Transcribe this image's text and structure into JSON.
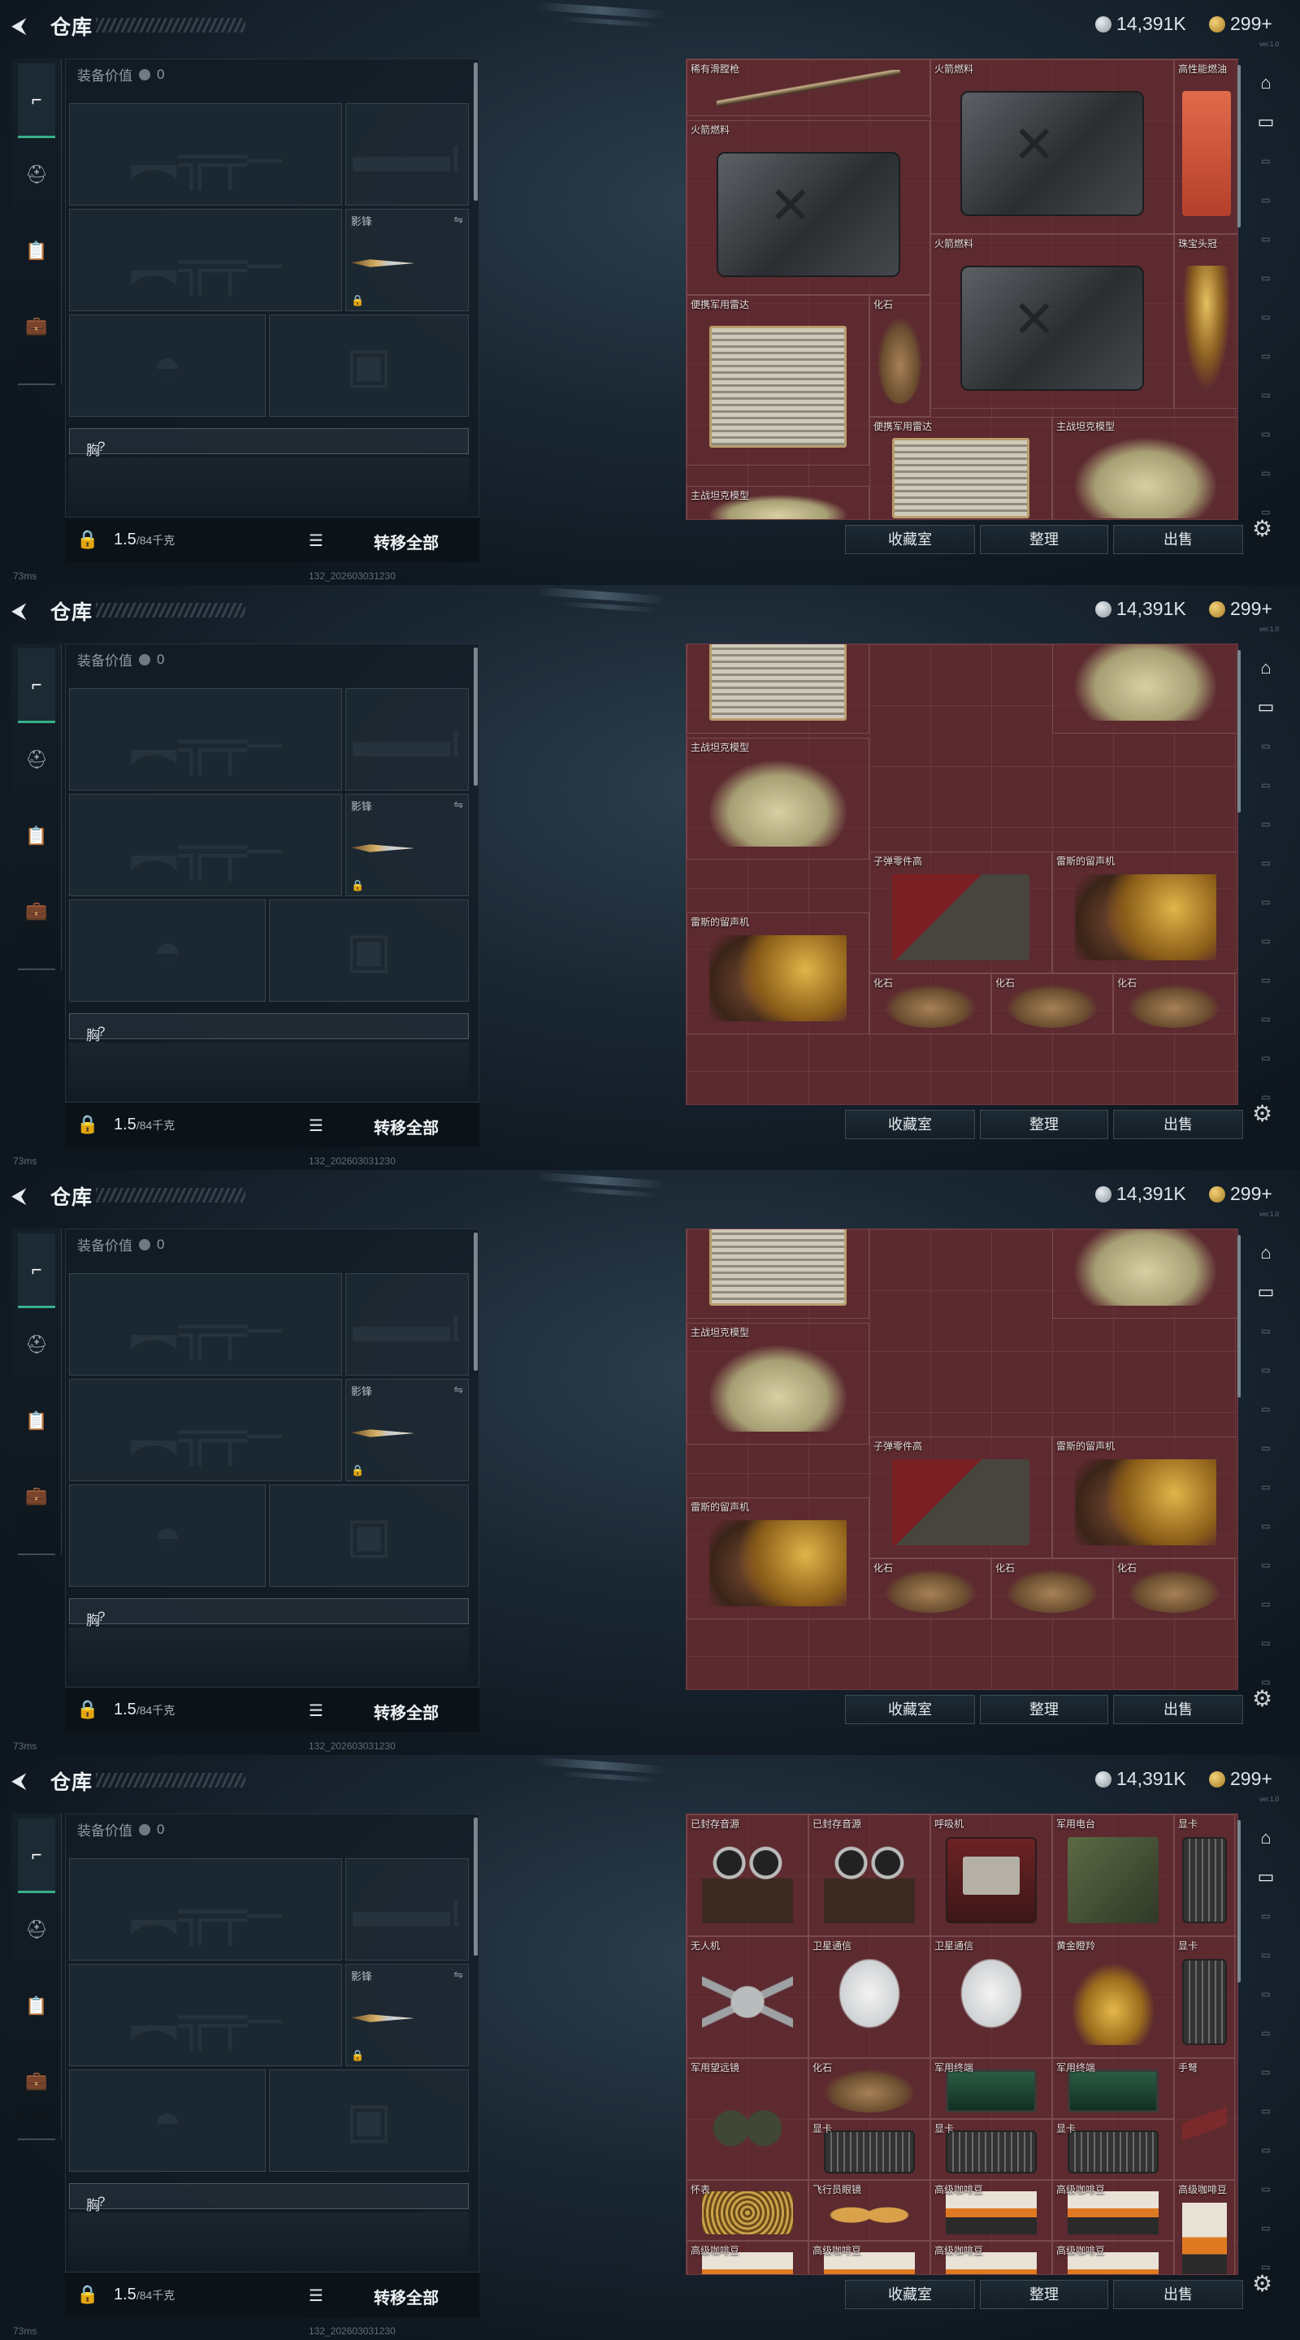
{
  "header": {
    "title": "仓库",
    "currency_silver": "14,391K",
    "currency_gold": "299+",
    "corner_text": "ver.1.0"
  },
  "left_nav": {
    "icons": [
      "pistol-icon",
      "helmet-icon",
      "clipboard-icon",
      "briefcase-icon"
    ]
  },
  "loadout": {
    "equip_value_label": "装备价值",
    "equip_value": "0",
    "knife_label": "影锋",
    "chest_rig_label": "胸挂",
    "chest_rig_help": "?"
  },
  "bottom_left": {
    "weight_current": "1.5",
    "weight_max": "/84千克",
    "transfer_all": "转移全部"
  },
  "status_bar": {
    "ping": "73ms",
    "build": "132_202603031230"
  },
  "actions": {
    "collection": "收藏室",
    "organize": "整理",
    "sell": "出售"
  },
  "frames": [
    {
      "items": [
        {
          "name": "稀有滑膛枪",
          "type": "rifle"
        },
        {
          "name": "火箭燃料",
          "type": "jerry"
        },
        {
          "name": "高性能燃油",
          "type": "redstick"
        },
        {
          "name": "火箭燃料",
          "type": "jerry"
        },
        {
          "name": "火箭燃料",
          "type": "jerry"
        },
        {
          "name": "珠宝头冠",
          "type": "crown"
        },
        {
          "name": "便携军用雷达",
          "type": "radar"
        },
        {
          "name": "化石",
          "type": "fossil"
        },
        {
          "name": "便携军用雷达",
          "type": "radar"
        },
        {
          "name": "主战坦克模型",
          "type": "tank"
        },
        {
          "name": "主战坦克模型",
          "type": "tank"
        }
      ]
    },
    {
      "items": [
        {
          "name": "便携军用雷达",
          "type": "radar"
        },
        {
          "name": "主战坦克模型",
          "type": "tank"
        },
        {
          "name": "主战坦克模型",
          "type": "tank"
        },
        {
          "name": "子弹零件高",
          "type": "ammo"
        },
        {
          "name": "雷斯的留声机",
          "type": "phono"
        },
        {
          "name": "雷斯的留声机",
          "type": "phono"
        },
        {
          "name": "化石",
          "type": "fossil"
        },
        {
          "name": "化石",
          "type": "fossil"
        },
        {
          "name": "化石",
          "type": "fossil"
        }
      ]
    },
    {
      "items": [
        {
          "name": "便携军用雷达",
          "type": "radar"
        },
        {
          "name": "主战坦克模型",
          "type": "tank"
        },
        {
          "name": "主战坦克模型",
          "type": "tank"
        },
        {
          "name": "子弹零件高",
          "type": "ammo"
        },
        {
          "name": "雷斯的留声机",
          "type": "phono"
        },
        {
          "name": "雷斯的留声机",
          "type": "phono"
        },
        {
          "name": "化石",
          "type": "fossil"
        },
        {
          "name": "化石",
          "type": "fossil"
        },
        {
          "name": "化石",
          "type": "fossil"
        }
      ]
    },
    {
      "items": [
        {
          "name": "已封存音源",
          "type": "reel"
        },
        {
          "name": "已封存音源",
          "type": "reel"
        },
        {
          "name": "呼吸机",
          "type": "terminal"
        },
        {
          "name": "军用电台",
          "type": "radio"
        },
        {
          "name": "显卡",
          "type": "gpu"
        },
        {
          "name": "无人机",
          "type": "drone"
        },
        {
          "name": "卫星通信",
          "type": "dish"
        },
        {
          "name": "卫星通信",
          "type": "dish"
        },
        {
          "name": "黄金瞪羚",
          "type": "deer"
        },
        {
          "name": "显卡",
          "type": "gpu"
        },
        {
          "name": "军用望远镜",
          "type": "bino"
        },
        {
          "name": "化石",
          "type": "fossil"
        },
        {
          "name": "军用终端",
          "type": "tab"
        },
        {
          "name": "军用终端",
          "type": "tab"
        },
        {
          "name": "手弩",
          "type": "hand"
        },
        {
          "name": "显卡",
          "type": "gpu"
        },
        {
          "name": "显卡",
          "type": "gpu"
        },
        {
          "name": "显卡",
          "type": "gpu"
        },
        {
          "name": "怀表",
          "type": "chain"
        },
        {
          "name": "飞行员眼镜",
          "type": "glasses"
        },
        {
          "name": "高级咖啡豆",
          "type": "coffee"
        },
        {
          "name": "高级咖啡豆",
          "type": "coffee"
        },
        {
          "name": "高级咖啡豆",
          "type": "coffee"
        },
        {
          "name": "高级咖啡豆",
          "type": "coffee"
        },
        {
          "name": "高级咖啡豆",
          "type": "coffee"
        },
        {
          "name": "高级咖啡豆",
          "type": "coffee"
        },
        {
          "name": "高级咖啡豆",
          "type": "coffee"
        }
      ]
    }
  ]
}
